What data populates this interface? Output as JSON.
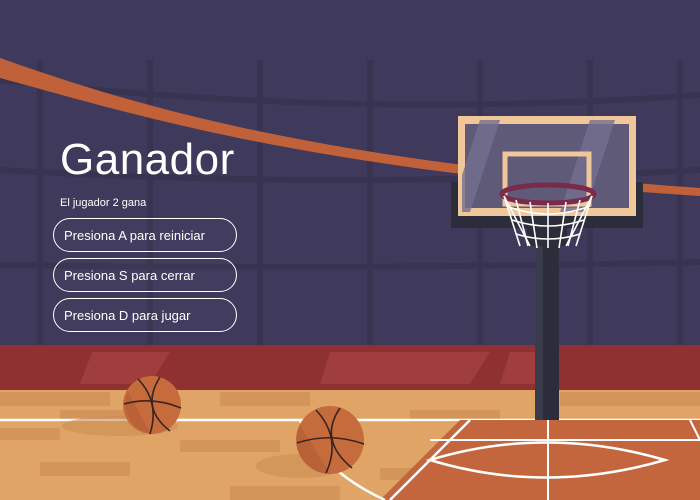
{
  "screen": {
    "title": "Ganador",
    "subtitle": "El jugador 2 gana"
  },
  "menu": {
    "buttons": [
      {
        "label": "Presiona A para reiniciar"
      },
      {
        "label": "Presiona S para cerrar"
      },
      {
        "label": "Presiona D para jugar"
      }
    ]
  },
  "colors": {
    "background": "#3f3a5c",
    "arc_stripe": "#c0613a",
    "wall_band": "#8f3131",
    "court_wood": "#e0a566",
    "court_paint": "#c4663d",
    "ball": "#c56b3c",
    "backboard_frame": "#f0c79b",
    "rim": "#7a2b49",
    "pole": "#2c2d3a"
  },
  "icons": {
    "ball": "basketball-icon",
    "hoop": "hoop-icon"
  }
}
